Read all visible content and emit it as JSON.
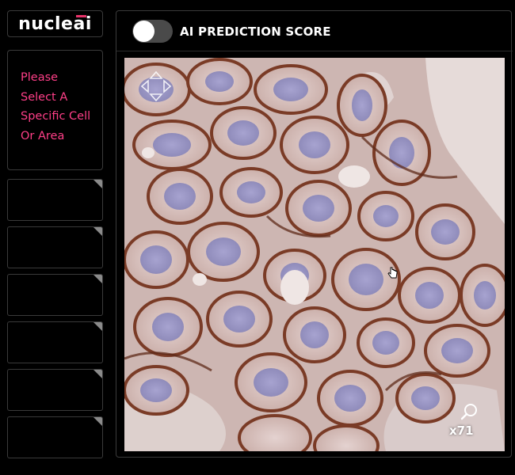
{
  "logo": {
    "text": "nucleai"
  },
  "sidebar": {
    "instruction": "Please\nSelect A\nSpecific Cell\nOr Area",
    "slot_count": 6
  },
  "main": {
    "toggle": {
      "state": "off"
    },
    "title": "AI PREDICTION SCORE",
    "viewer": {
      "zoom_label": "x71",
      "image": "IHC-stained tissue, brown membrane stain, purple nuclei"
    }
  },
  "colors": {
    "accent_pink": "#ff3f88",
    "logo_bar": "#e8336a",
    "panel_border": "#3a3a3a",
    "toggle_track": "#4a4a4a",
    "membrane_stain": "#7a3b26",
    "nucleus": "#9c98c6",
    "background_tissue": "#d7c8c6"
  },
  "icons": {
    "pan": "pan-arrows-icon",
    "zoom": "zoom-magnifier-icon",
    "cursor": "hand-cursor-icon"
  }
}
